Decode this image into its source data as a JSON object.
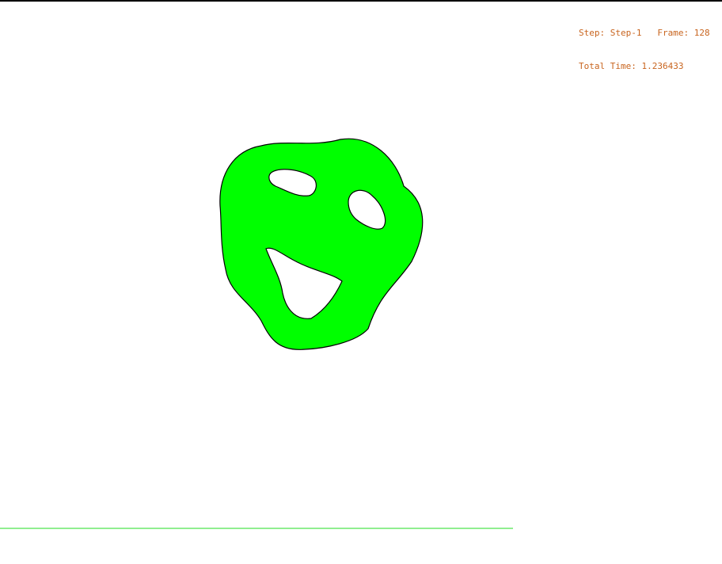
{
  "hud": {
    "step_label": "Step:",
    "step_value": "Step-1",
    "frame_label": "Frame:",
    "frame_value": "128",
    "total_time_label": "Total Time:",
    "total_time_value": "1.236433"
  },
  "colors": {
    "body_fill": "#00ff00",
    "body_outline": "#000000",
    "hud_text": "#c8641e",
    "ground": "#90ee90",
    "background": "#ffffff",
    "frame_border": "#000000"
  }
}
